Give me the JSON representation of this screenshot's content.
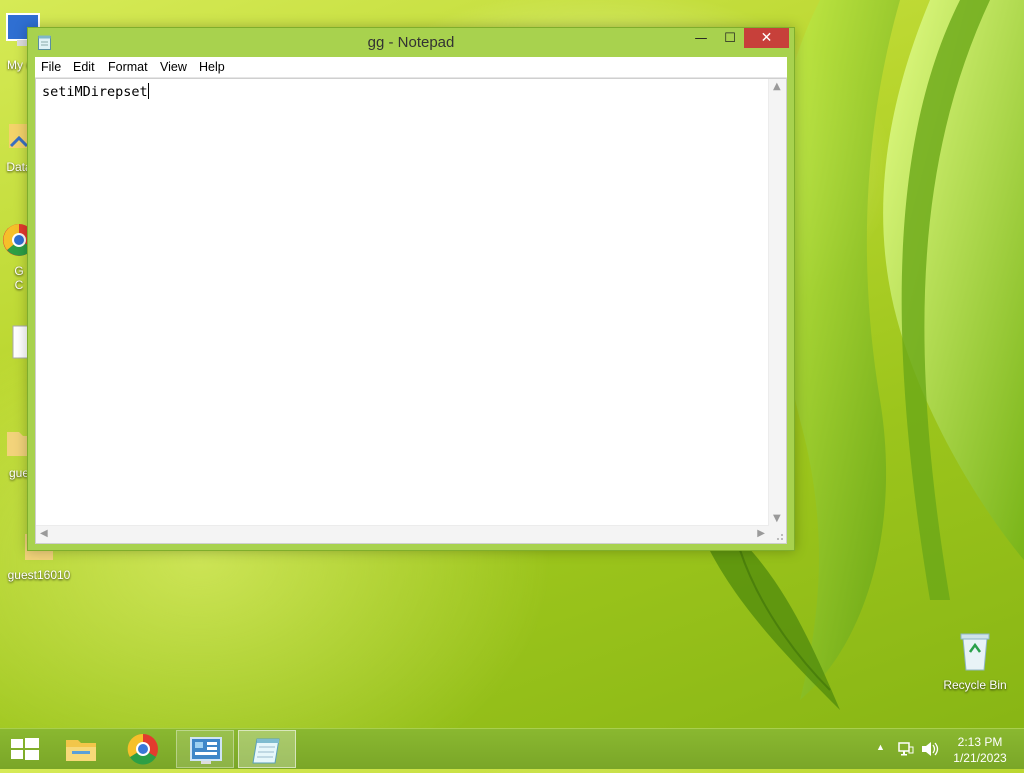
{
  "desktop": {
    "icons": [
      {
        "label": "My C",
        "icon": "computer-icon"
      },
      {
        "label": "Data",
        "icon": "shortcut-icon"
      },
      {
        "label": "G\nC",
        "icon": "chrome-icon"
      },
      {
        "label": "",
        "icon": "document-icon"
      },
      {
        "label": "gue",
        "icon": "user-folder-icon"
      },
      {
        "label": "guest16010",
        "icon": "user-folder-icon"
      },
      {
        "label": "Recycle Bin",
        "icon": "recycle-bin-icon"
      }
    ]
  },
  "window": {
    "title": "gg - Notepad",
    "minimize_glyph": "—",
    "maximize_glyph": "☐",
    "close_glyph": "✕",
    "menu": [
      "File",
      "Edit",
      "Format",
      "View",
      "Help"
    ],
    "content": "setiMDirepset"
  },
  "taskbar": {
    "items": [
      "start-button",
      "file-explorer",
      "chrome",
      "control-panel",
      "notepad"
    ],
    "clock_time": "2:13 PM",
    "clock_date": "1/21/2023"
  },
  "colors": {
    "window_frame": "#a8d24e",
    "close_button": "#c7403a",
    "taskbar": "#7aa628"
  }
}
